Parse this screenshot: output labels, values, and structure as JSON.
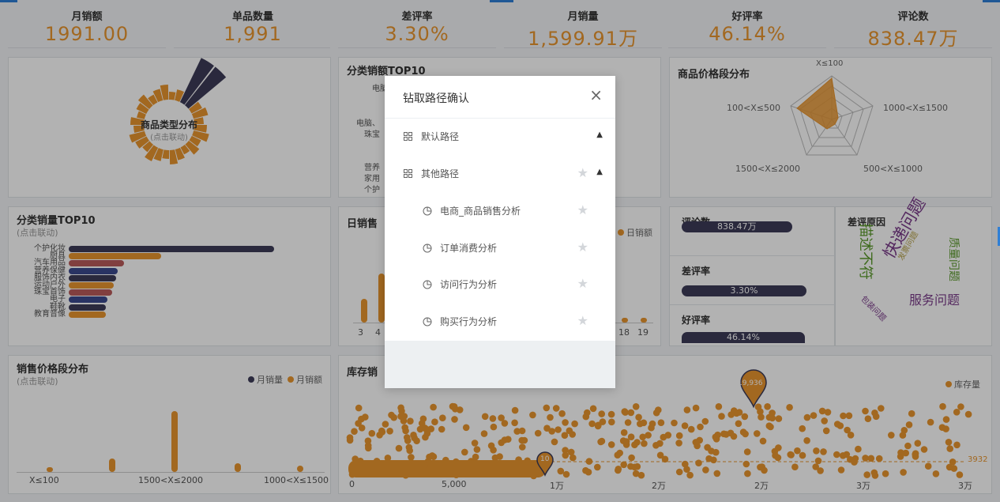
{
  "kpis": [
    {
      "label": "月销额",
      "value": "1991.00"
    },
    {
      "label": "单品数量",
      "value": "1,991"
    },
    {
      "label": "差评率",
      "value": "3.30%"
    },
    {
      "label": "月销量",
      "value": "1,599.91万"
    },
    {
      "label": "好评率",
      "value": "46.14%"
    },
    {
      "label": "评论数",
      "value": "838.47万"
    }
  ],
  "category_type": {
    "title": "商品类型分布",
    "subtitle": "(点击联动)"
  },
  "top10_sales_amount": {
    "title": "分类销额TOP10",
    "visible_labels": [
      "电脑",
      "电脑、",
      "珠宝",
      "营养",
      "家用",
      "个护"
    ]
  },
  "price_range": {
    "title": "商品价格段分布",
    "axes": [
      "X≤100",
      "1000<X≤1500",
      "500<X≤1000",
      "1500<X≤2000",
      "100<X≤500"
    ]
  },
  "top10_sales_qty": {
    "title": "分类销量TOP10",
    "subtitle": "(点击联动)",
    "chart_data": {
      "type": "bar",
      "categories": [
        "个护化妆",
        "厨具",
        "汽车用品",
        "营养保健",
        "服饰内衣",
        "运动户外",
        "珠宝首饰",
        "电子",
        "鞋靴",
        "教育音像"
      ],
      "values": [
        100,
        45,
        27,
        24,
        23,
        22,
        21,
        19,
        18,
        18
      ],
      "colors": [
        "#3d3b58",
        "#e8952f",
        "#b95b5b",
        "#3c4a8e",
        "#3d3b58",
        "#e8952f",
        "#b95b5b",
        "#3c4a8e",
        "#3d3b58",
        "#e8952f"
      ]
    }
  },
  "daily_sales": {
    "title": "日销售",
    "legend": "日销额",
    "xticks": [
      "3",
      "4",
      "18",
      "19"
    ]
  },
  "review_count": {
    "label": "评论数",
    "value": "838.47万",
    "fill": 1.0
  },
  "bad_rate": {
    "label": "差评率",
    "value": "3.30%",
    "fill": 1.0
  },
  "good_rate": {
    "label": "好评率",
    "value": "46.14%",
    "fill": 1.0
  },
  "bad_reasons": {
    "title": "差评原因",
    "words": [
      "快递问题",
      "描述不符",
      "服务问题",
      "质量问题",
      "发票问题",
      "包装问题"
    ]
  },
  "sales_price_range": {
    "title": "销售价格段分布",
    "subtitle": "(点击联动)",
    "legend": [
      "月销量",
      "月销额"
    ],
    "xticks": [
      "X≤100",
      "1500<X≤2000",
      "1000<X≤1500"
    ]
  },
  "inventory": {
    "title": "库存销",
    "legend": "库存量",
    "xticks": [
      "0",
      "5,000",
      "1万",
      "2万",
      "2万",
      "3万",
      "3万"
    ],
    "pin_top": "19,936",
    "pin_low": "10",
    "right_label": "3932"
  },
  "modal": {
    "title": "钻取路径确认",
    "close": "×",
    "groups": [
      {
        "label": "默认路径",
        "icon": "grid-icon",
        "expanded": false
      },
      {
        "label": "其他路径",
        "icon": "grid-icon",
        "expanded": true
      }
    ],
    "items": [
      {
        "label": "电商_商品销售分析",
        "icon": "pie-icon"
      },
      {
        "label": "订单消费分析",
        "icon": "pie-icon"
      },
      {
        "label": "访问行为分析",
        "icon": "pie-icon"
      },
      {
        "label": "购买行为分析",
        "icon": "pie-icon"
      }
    ]
  },
  "colors": {
    "accent": "#e8952f",
    "dark": "#3d3b58",
    "blue": "#2f7fd6"
  }
}
